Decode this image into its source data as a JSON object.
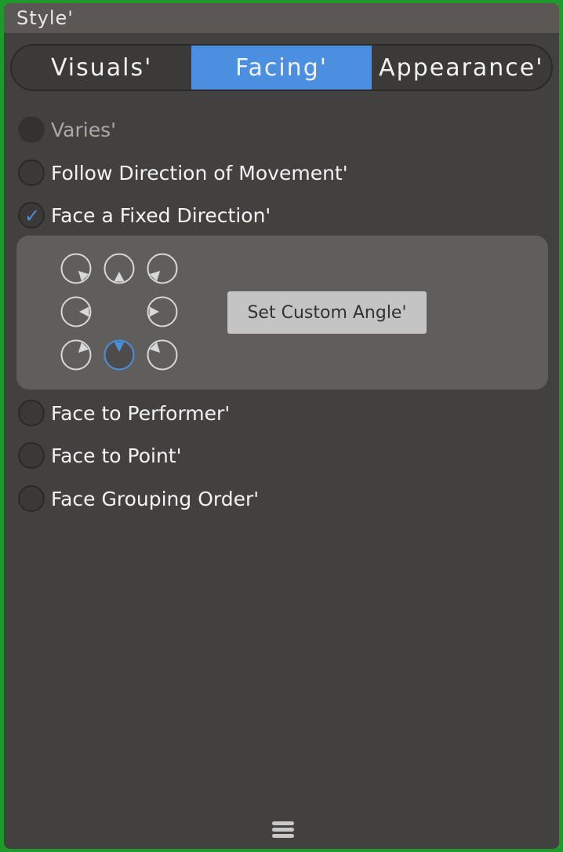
{
  "panel": {
    "title": "Style'"
  },
  "tabs": [
    {
      "label": "Visuals'",
      "active": false
    },
    {
      "label": "Facing'",
      "active": true
    },
    {
      "label": "Appearance'",
      "active": false
    }
  ],
  "options": {
    "varies": {
      "label": "Varies'",
      "state": "disabled"
    },
    "follow": {
      "label": "Follow Direction of Movement'",
      "state": "unchecked"
    },
    "fixed": {
      "label": "Face a Fixed Direction'",
      "state": "checked"
    },
    "performer": {
      "label": "Face to Performer'",
      "state": "unchecked"
    },
    "point": {
      "label": "Face to Point'",
      "state": "unchecked"
    },
    "grouping": {
      "label": "Face Grouping Order'",
      "state": "unchecked"
    }
  },
  "fixed_direction": {
    "selected": "down",
    "directions": [
      "up-left",
      "up",
      "up-right",
      "left",
      "right",
      "down-left",
      "down",
      "down-right"
    ],
    "custom_button": "Set Custom Angle'"
  },
  "colors": {
    "accent": "#4a8fe0",
    "panel": "#434140",
    "subpanel": "#5f5e5d"
  },
  "icons": {
    "check": "check-icon",
    "handle": "drag-handle-icon"
  }
}
